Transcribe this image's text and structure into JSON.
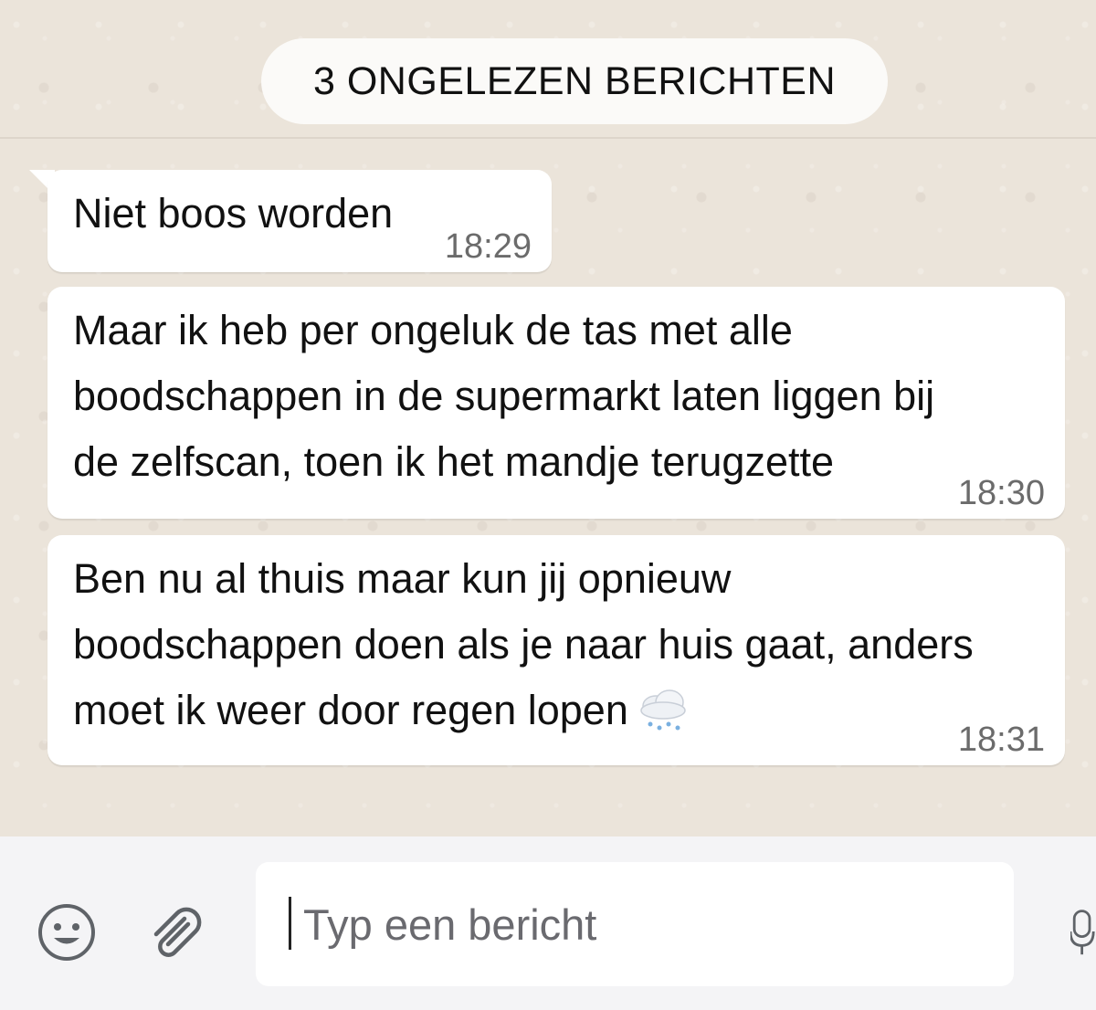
{
  "unread_banner": "3 ONGELEZEN BERICHTEN",
  "messages": [
    {
      "text": "Niet boos worden",
      "time": "18:29"
    },
    {
      "text": "Maar ik heb per ongeluk de tas met alle\nboodschappen in de supermarkt laten liggen bij\nde zelfscan, toen ik het mandje terugzette",
      "time": "18:30"
    },
    {
      "text": "Ben nu al thuis maar kun jij opnieuw\nboodschappen doen als je naar huis gaat, anders\nmoet ik weer door regen lopen",
      "time": "18:31",
      "emoji": "cloud-with-rain"
    }
  ],
  "composer": {
    "placeholder": "Typ een bericht",
    "emoji_icon": "emoji-icon",
    "attach_icon": "paperclip-icon",
    "mic_icon": "microphone-icon"
  }
}
